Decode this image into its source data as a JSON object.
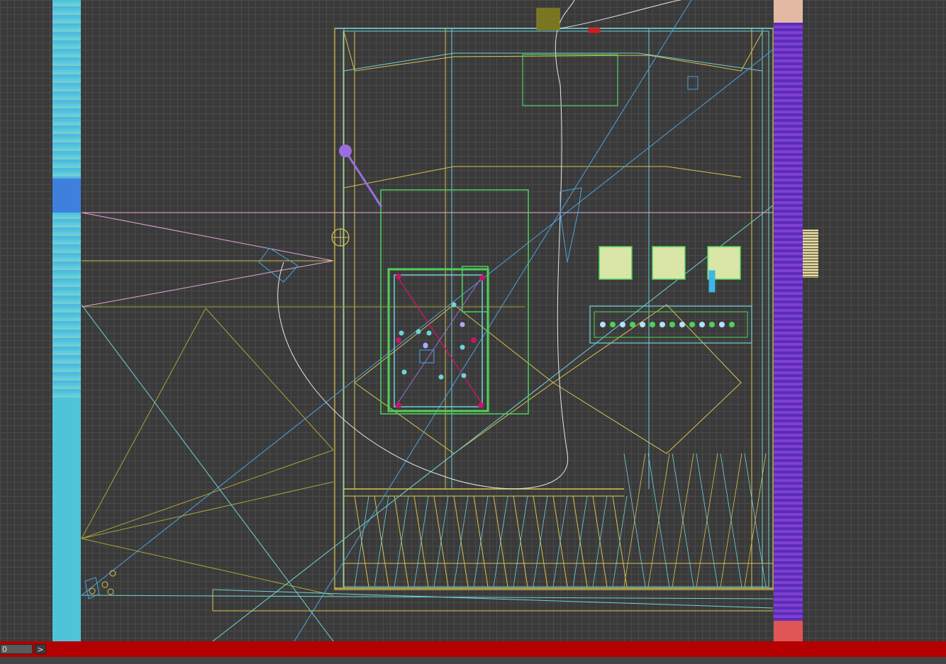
{
  "viewport": {
    "grid_color": "#4a4a4a",
    "background": "#3a3a3a"
  },
  "colors": {
    "yellow": "#d6c34f",
    "olive": "#a9a23a",
    "cyan": "#6fd3d9",
    "blue": "#4aa3e0",
    "green": "#4fd15a",
    "pink": "#e3a6d8",
    "white": "#e8e8e8",
    "purple": "#9a6ee0",
    "magenta": "#c2186b",
    "red": "#d21a1a",
    "pale_green_fill": "#d9e6a8"
  },
  "statusbar": {
    "frame_value": "0",
    "next_label": ">",
    "color": "#b40000"
  },
  "icons": {
    "next": "chevron-right-icon"
  }
}
